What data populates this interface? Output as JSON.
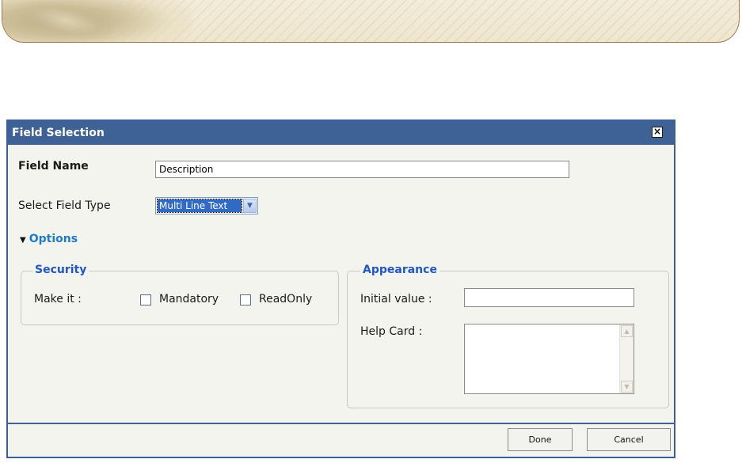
{
  "dialog": {
    "title": "Field Selection",
    "close_icon": "close-icon",
    "field_name_label": "Field Name",
    "field_name_value": "Description",
    "field_type_label": "Select Field Type",
    "field_type_value": "Multi Line Text",
    "options_label": "Options",
    "security": {
      "legend": "Security",
      "make_it_label": "Make it :",
      "mandatory_label": "Mandatory",
      "readonly_label": "ReadOnly"
    },
    "appearance": {
      "legend": "Appearance",
      "initial_value_label": "Initial value :",
      "initial_value": "",
      "help_card_label": "Help Card :",
      "help_card_value": ""
    },
    "done_label": "Done",
    "cancel_label": "Cancel"
  },
  "colors": {
    "titlebar": "#3f6296",
    "legend": "#1f56c8",
    "options_link": "#1e7bc4",
    "dialog_bg": "#f4f4ee"
  }
}
